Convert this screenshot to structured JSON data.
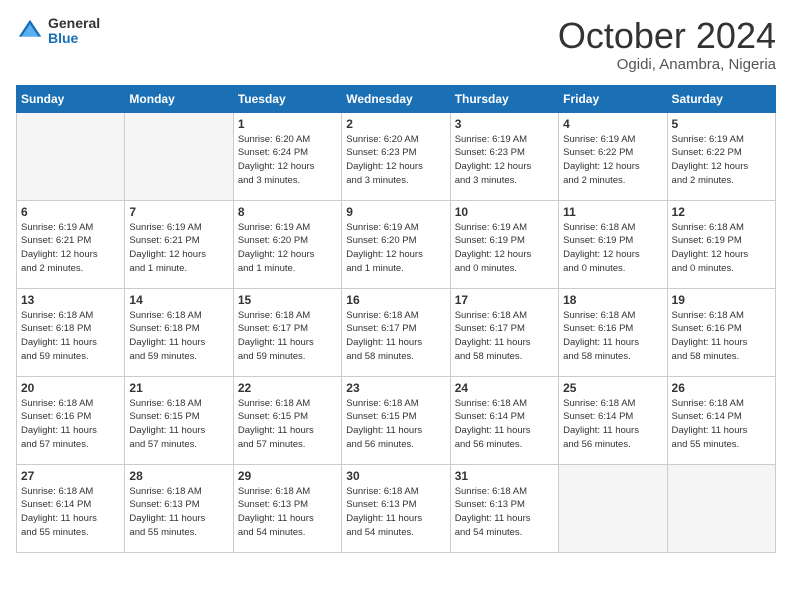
{
  "header": {
    "logo_general": "General",
    "logo_blue": "Blue",
    "month_title": "October 2024",
    "location": "Ogidi, Anambra, Nigeria"
  },
  "days_of_week": [
    "Sunday",
    "Monday",
    "Tuesday",
    "Wednesday",
    "Thursday",
    "Friday",
    "Saturday"
  ],
  "weeks": [
    [
      {
        "day": "",
        "info": ""
      },
      {
        "day": "",
        "info": ""
      },
      {
        "day": "1",
        "info": "Sunrise: 6:20 AM\nSunset: 6:24 PM\nDaylight: 12 hours\nand 3 minutes."
      },
      {
        "day": "2",
        "info": "Sunrise: 6:20 AM\nSunset: 6:23 PM\nDaylight: 12 hours\nand 3 minutes."
      },
      {
        "day": "3",
        "info": "Sunrise: 6:19 AM\nSunset: 6:23 PM\nDaylight: 12 hours\nand 3 minutes."
      },
      {
        "day": "4",
        "info": "Sunrise: 6:19 AM\nSunset: 6:22 PM\nDaylight: 12 hours\nand 2 minutes."
      },
      {
        "day": "5",
        "info": "Sunrise: 6:19 AM\nSunset: 6:22 PM\nDaylight: 12 hours\nand 2 minutes."
      }
    ],
    [
      {
        "day": "6",
        "info": "Sunrise: 6:19 AM\nSunset: 6:21 PM\nDaylight: 12 hours\nand 2 minutes."
      },
      {
        "day": "7",
        "info": "Sunrise: 6:19 AM\nSunset: 6:21 PM\nDaylight: 12 hours\nand 1 minute."
      },
      {
        "day": "8",
        "info": "Sunrise: 6:19 AM\nSunset: 6:20 PM\nDaylight: 12 hours\nand 1 minute."
      },
      {
        "day": "9",
        "info": "Sunrise: 6:19 AM\nSunset: 6:20 PM\nDaylight: 12 hours\nand 1 minute."
      },
      {
        "day": "10",
        "info": "Sunrise: 6:19 AM\nSunset: 6:19 PM\nDaylight: 12 hours\nand 0 minutes."
      },
      {
        "day": "11",
        "info": "Sunrise: 6:18 AM\nSunset: 6:19 PM\nDaylight: 12 hours\nand 0 minutes."
      },
      {
        "day": "12",
        "info": "Sunrise: 6:18 AM\nSunset: 6:19 PM\nDaylight: 12 hours\nand 0 minutes."
      }
    ],
    [
      {
        "day": "13",
        "info": "Sunrise: 6:18 AM\nSunset: 6:18 PM\nDaylight: 11 hours\nand 59 minutes."
      },
      {
        "day": "14",
        "info": "Sunrise: 6:18 AM\nSunset: 6:18 PM\nDaylight: 11 hours\nand 59 minutes."
      },
      {
        "day": "15",
        "info": "Sunrise: 6:18 AM\nSunset: 6:17 PM\nDaylight: 11 hours\nand 59 minutes."
      },
      {
        "day": "16",
        "info": "Sunrise: 6:18 AM\nSunset: 6:17 PM\nDaylight: 11 hours\nand 58 minutes."
      },
      {
        "day": "17",
        "info": "Sunrise: 6:18 AM\nSunset: 6:17 PM\nDaylight: 11 hours\nand 58 minutes."
      },
      {
        "day": "18",
        "info": "Sunrise: 6:18 AM\nSunset: 6:16 PM\nDaylight: 11 hours\nand 58 minutes."
      },
      {
        "day": "19",
        "info": "Sunrise: 6:18 AM\nSunset: 6:16 PM\nDaylight: 11 hours\nand 58 minutes."
      }
    ],
    [
      {
        "day": "20",
        "info": "Sunrise: 6:18 AM\nSunset: 6:16 PM\nDaylight: 11 hours\nand 57 minutes."
      },
      {
        "day": "21",
        "info": "Sunrise: 6:18 AM\nSunset: 6:15 PM\nDaylight: 11 hours\nand 57 minutes."
      },
      {
        "day": "22",
        "info": "Sunrise: 6:18 AM\nSunset: 6:15 PM\nDaylight: 11 hours\nand 57 minutes."
      },
      {
        "day": "23",
        "info": "Sunrise: 6:18 AM\nSunset: 6:15 PM\nDaylight: 11 hours\nand 56 minutes."
      },
      {
        "day": "24",
        "info": "Sunrise: 6:18 AM\nSunset: 6:14 PM\nDaylight: 11 hours\nand 56 minutes."
      },
      {
        "day": "25",
        "info": "Sunrise: 6:18 AM\nSunset: 6:14 PM\nDaylight: 11 hours\nand 56 minutes."
      },
      {
        "day": "26",
        "info": "Sunrise: 6:18 AM\nSunset: 6:14 PM\nDaylight: 11 hours\nand 55 minutes."
      }
    ],
    [
      {
        "day": "27",
        "info": "Sunrise: 6:18 AM\nSunset: 6:14 PM\nDaylight: 11 hours\nand 55 minutes."
      },
      {
        "day": "28",
        "info": "Sunrise: 6:18 AM\nSunset: 6:13 PM\nDaylight: 11 hours\nand 55 minutes."
      },
      {
        "day": "29",
        "info": "Sunrise: 6:18 AM\nSunset: 6:13 PM\nDaylight: 11 hours\nand 54 minutes."
      },
      {
        "day": "30",
        "info": "Sunrise: 6:18 AM\nSunset: 6:13 PM\nDaylight: 11 hours\nand 54 minutes."
      },
      {
        "day": "31",
        "info": "Sunrise: 6:18 AM\nSunset: 6:13 PM\nDaylight: 11 hours\nand 54 minutes."
      },
      {
        "day": "",
        "info": ""
      },
      {
        "day": "",
        "info": ""
      }
    ]
  ]
}
